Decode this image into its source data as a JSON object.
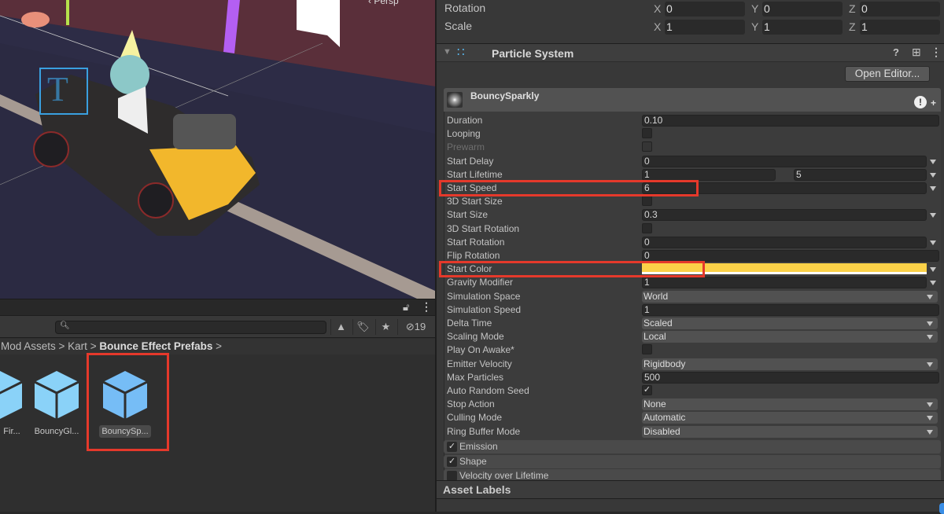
{
  "scene": {
    "camera_label": "Persp",
    "gizmo_text": "T"
  },
  "project": {
    "breadcrumb": [
      "Mod Assets",
      "Kart",
      "Bounce Effect Prefabs"
    ],
    "search_placeholder": "",
    "hidden_count": "19",
    "assets": [
      {
        "name": "Fir...",
        "selected": false
      },
      {
        "name": "BouncyGl...",
        "selected": false
      },
      {
        "name": "BouncySp...",
        "selected": true
      }
    ]
  },
  "inspector": {
    "transform": {
      "rotation_label": "Rotation",
      "rotation": {
        "x": "0",
        "y": "0",
        "z": "0"
      },
      "scale_label": "Scale",
      "scale": {
        "x": "1",
        "y": "1",
        "z": "1"
      },
      "axis": {
        "x": "X",
        "y": "Y",
        "z": "Z"
      }
    },
    "component_title": "Particle System",
    "open_editor_label": "Open Editor...",
    "module_name": "BouncySparkly",
    "start_color_hex": "#fbd148",
    "highlight_color": "#e5392b",
    "rows": [
      {
        "label": "Duration",
        "type": "field",
        "value": "0.10"
      },
      {
        "label": "Looping",
        "type": "check",
        "checked": false
      },
      {
        "label": "Prewarm",
        "type": "check",
        "checked": false,
        "disabled": true
      },
      {
        "label": "Start Delay",
        "type": "field-arrow",
        "value": "0"
      },
      {
        "label": "Start Lifetime",
        "type": "two",
        "value": "1",
        "value2": "5"
      },
      {
        "label": "Start Speed",
        "type": "field-arrow",
        "value": "6"
      },
      {
        "label": "3D Start Size",
        "type": "check",
        "checked": false
      },
      {
        "label": "Start Size",
        "type": "field-arrow",
        "value": "0.3"
      },
      {
        "label": "3D Start Rotation",
        "type": "check",
        "checked": false
      },
      {
        "label": "Start Rotation",
        "type": "field-arrow",
        "value": "0"
      },
      {
        "label": "Flip Rotation",
        "type": "field",
        "value": "0"
      },
      {
        "label": "Start Color",
        "type": "color",
        "value": ""
      },
      {
        "label": "Gravity Modifier",
        "type": "field-arrow",
        "value": "1"
      },
      {
        "label": "Simulation Space",
        "type": "dropdown",
        "value": "World"
      },
      {
        "label": "Simulation Speed",
        "type": "field",
        "value": "1"
      },
      {
        "label": "Delta Time",
        "type": "dropdown",
        "value": "Scaled"
      },
      {
        "label": "Scaling Mode",
        "type": "dropdown",
        "value": "Local"
      },
      {
        "label": "Play On Awake*",
        "type": "check",
        "checked": false
      },
      {
        "label": "Emitter Velocity",
        "type": "dropdown",
        "value": "Rigidbody"
      },
      {
        "label": "Max Particles",
        "type": "field",
        "value": "500"
      },
      {
        "label": "Auto Random Seed",
        "type": "check",
        "checked": true
      },
      {
        "label": "Stop Action",
        "type": "dropdown",
        "value": "None"
      },
      {
        "label": "Culling Mode",
        "type": "dropdown",
        "value": "Automatic"
      },
      {
        "label": "Ring Buffer Mode",
        "type": "dropdown",
        "value": "Disabled"
      }
    ],
    "submodules": [
      {
        "label": "Emission",
        "checked": true
      },
      {
        "label": "Shape",
        "checked": true
      },
      {
        "label": "Velocity over Lifetime",
        "checked": false
      }
    ],
    "asset_labels": "Asset Labels"
  }
}
